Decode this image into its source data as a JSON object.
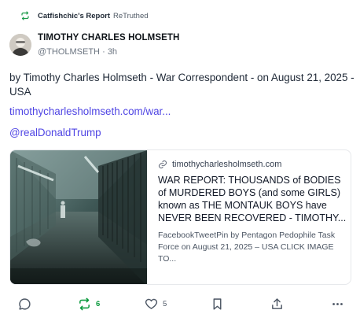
{
  "retruth": {
    "account": "Catfishchic's Report",
    "label": "ReTruthed"
  },
  "author": {
    "name": "TIMOTHY CHARLES HOLMSETH",
    "handle": "@THOLMSETH",
    "separator": "·",
    "time": "3h"
  },
  "post": {
    "text": "by Timothy Charles Holmseth - War Correspondent - on August 21, 2025 - USA",
    "link": "timothycharlesholmseth.com/war...",
    "mention": "@realDonaldTrump"
  },
  "card": {
    "domain": "timothycharlesholmseth.com",
    "title": "WAR REPORT: THOUSANDS of BODIES of MURDERED BOYS (and some GIRLS) known as THE MONTAUK BOYS have NEVER BEEN RECOVERED - TIMOTHY...",
    "description": "FacebookTweetPin by Pentagon Pedophile Task Force on August 21, 2025 – USA CLICK IMAGE TO..."
  },
  "actions": {
    "retruth_count": "6",
    "like_count": "5"
  },
  "colors": {
    "link": "#5046e4",
    "retruth_green": "#0c9a3e"
  },
  "icons": [
    "retruth-icon",
    "link-icon",
    "reply-icon",
    "heart-icon",
    "bookmark-icon",
    "share-icon",
    "more-icon"
  ]
}
